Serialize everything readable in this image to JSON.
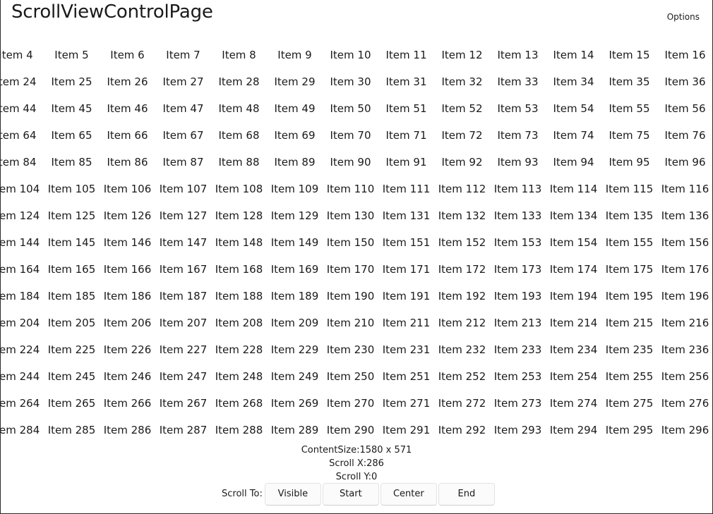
{
  "page": {
    "title": "ScrollViewControlPage",
    "options_label": "Options"
  },
  "grid": {
    "columns": 20,
    "rows": 15,
    "item_prefix": "Item"
  },
  "scroll_view": {
    "content_size": "ContentSize:1580 x 571",
    "scroll_x": "Scroll X:286",
    "scroll_y": "Scroll Y:0",
    "scroll_x_value": 286,
    "scroll_y_value": 0
  },
  "scroll_to": {
    "label": "Scroll To:",
    "buttons": [
      "Visible",
      "Start",
      "Center",
      "End"
    ]
  }
}
